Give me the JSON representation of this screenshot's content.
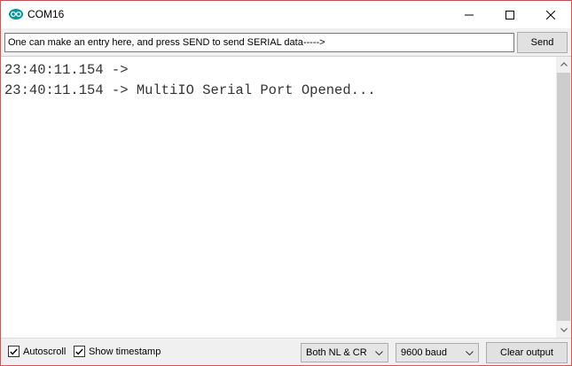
{
  "window": {
    "title": "COM16",
    "app_icon": "arduino-icon",
    "accent_color": "#00979c",
    "controls": {
      "minimize_icon": "minimize-icon",
      "maximize_icon": "maximize-icon",
      "close_icon": "close-icon"
    }
  },
  "input_row": {
    "value": "One can make an entry here, and press SEND to send SERIAL data----->",
    "send_label": "Send"
  },
  "output": {
    "lines": [
      "23:40:11.154 ->",
      "23:40:11.154 -> MultiIO Serial Port Opened..."
    ]
  },
  "bottombar": {
    "autoscroll_label": "Autoscroll",
    "autoscroll_checked": true,
    "timestamp_label": "Show timestamp",
    "timestamp_checked": true,
    "line_ending_selected": "Both NL & CR",
    "baud_selected": "9600 baud",
    "clear_label": "Clear output"
  }
}
